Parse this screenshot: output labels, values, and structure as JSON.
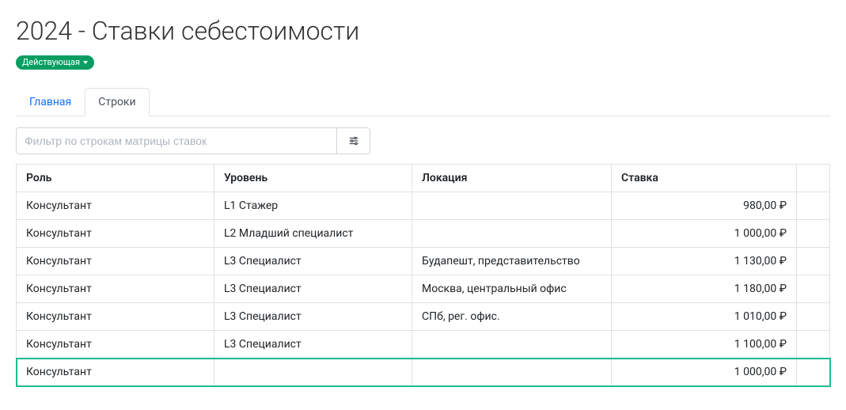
{
  "page": {
    "title": "2024 - Ставки себестоимости",
    "status_label": "Действующая"
  },
  "tabs": [
    {
      "label": "Главная",
      "active": false
    },
    {
      "label": "Строки",
      "active": true
    }
  ],
  "filter": {
    "placeholder": "Фильтр по строкам матрицы ставок"
  },
  "table": {
    "headers": {
      "role": "Роль",
      "level": "Уровень",
      "location": "Локация",
      "rate": "Ставка"
    },
    "rows": [
      {
        "role": "Консультант",
        "level": "L1 Стажер",
        "location": "",
        "rate": "980,00 ₽",
        "highlight": false
      },
      {
        "role": "Консультант",
        "level": "L2 Младший специалист",
        "location": "",
        "rate": "1 000,00 ₽",
        "highlight": false
      },
      {
        "role": "Консультант",
        "level": "L3 Специалист",
        "location": "Будапешт, представительство",
        "rate": "1 130,00 ₽",
        "highlight": false
      },
      {
        "role": "Консультант",
        "level": "L3 Специалист",
        "location": "Москва, центральный офис",
        "rate": "1 180,00 ₽",
        "highlight": false
      },
      {
        "role": "Консультант",
        "level": "L3 Специалист",
        "location": "СПб, рег. офис.",
        "rate": "1 010,00 ₽",
        "highlight": false
      },
      {
        "role": "Консультант",
        "level": "L3 Специалист",
        "location": "",
        "rate": "1 100,00 ₽",
        "highlight": false
      },
      {
        "role": "Консультант",
        "level": "",
        "location": "",
        "rate": "1 000,00 ₽",
        "highlight": true
      }
    ]
  }
}
